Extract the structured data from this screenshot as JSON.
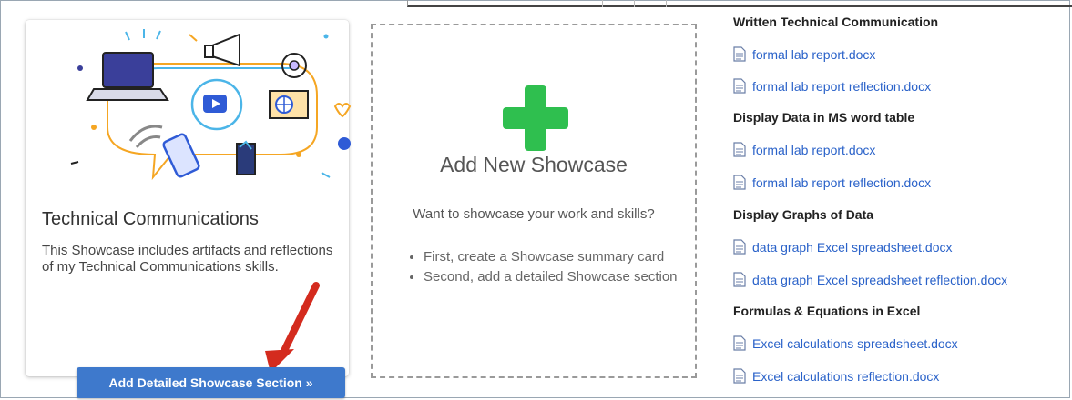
{
  "showcase_card": {
    "title": "Technical Communications",
    "description": "This Showcase includes artifacts and reflections of my Technical Communications skills.",
    "button_label": "Add Detailed Showcase Section »"
  },
  "add_card": {
    "title": "Add New Showcase",
    "question": "Want to showcase your work and skills?",
    "steps": [
      "First, create a Showcase summary card",
      "Second, add a detailed Showcase section"
    ]
  },
  "artifacts": {
    "sections": [
      {
        "heading": "Written Technical Communication",
        "files": [
          "formal lab report.docx",
          "formal lab report reflection.docx"
        ]
      },
      {
        "heading": "Display Data in MS word table",
        "files": [
          "formal lab report.docx",
          "formal lab report reflection.docx"
        ]
      },
      {
        "heading": "Display Graphs of Data",
        "files": [
          "data graph Excel spreadsheet.docx",
          "data graph Excel spreadsheet reflection.docx"
        ]
      },
      {
        "heading": "Formulas & Equations in Excel",
        "files": [
          "Excel calculations spreadsheet.docx",
          "Excel calculations reflection.docx"
        ]
      }
    ]
  },
  "colors": {
    "button": "#3e79cc",
    "plus": "#2fbf4f",
    "link": "#2a62c9",
    "arrow": "#d42b1e"
  },
  "icons": {
    "file": "document-icon",
    "plus": "plus-icon",
    "arrow": "red-arrow-pointer"
  }
}
